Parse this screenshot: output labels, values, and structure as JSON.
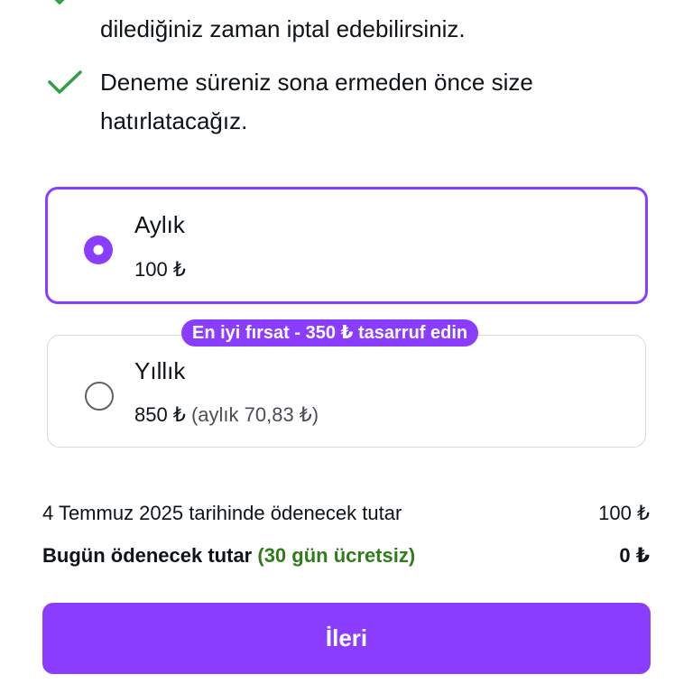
{
  "benefits": {
    "item1_line2": "dilediğiniz zaman iptal edebilirsiniz.",
    "item2_line1": "Deneme süreniz sona ermeden önce size",
    "item2_line2": "hatırlatacağız."
  },
  "plans": [
    {
      "name": "Aylık",
      "price": "100 ₺",
      "selected": true
    },
    {
      "name": "Yıllık",
      "price": "850 ₺",
      "note": "(aylık 70,83 ₺)",
      "badge": "En iyi fırsat - 350 ₺ tasarruf edin",
      "selected": false
    }
  ],
  "summary": {
    "due_date_label": "4 Temmuz 2025 tarihinde ödenecek tutar",
    "due_date_amount": "100 ₺",
    "today_label": "Bugün ödenecek tutar",
    "today_free_note": "(30 gün ücretsiz)",
    "today_amount": "0 ₺"
  },
  "next_button_label": "İleri",
  "colors": {
    "accent": "#8b3dff",
    "check": "#2f9e44",
    "free_note": "#2f7d1a"
  }
}
